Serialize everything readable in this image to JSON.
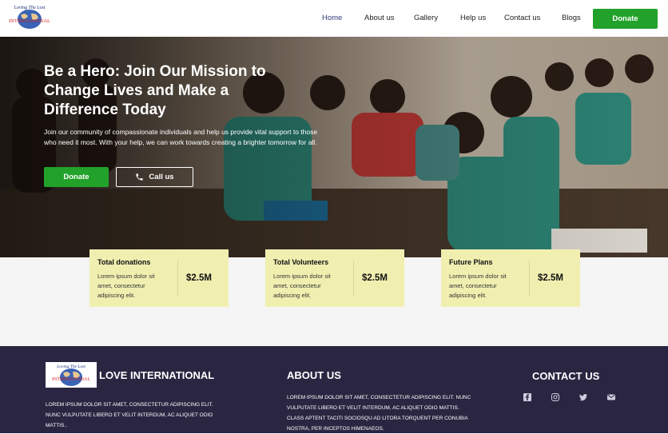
{
  "header": {
    "nav": [
      {
        "label": "Home",
        "active": true
      },
      {
        "label": "About us",
        "active": false
      },
      {
        "label": "Gallery",
        "active": false
      },
      {
        "label": "Help us",
        "active": false
      },
      {
        "label": "Contact us",
        "active": false
      },
      {
        "label": "Blogs",
        "active": false
      }
    ],
    "donate_label": "Donate"
  },
  "hero": {
    "title": "Be a Hero: Join Our Mission to Change Lives and Make a Difference Today",
    "text": "Join our community of compassionate individuals and help us provide vital support to those who need it most. With your help, we can work towards creating a brighter tomorrow for all.",
    "donate_label": "Donate",
    "call_label": "Call us"
  },
  "stats": [
    {
      "title": "Total donations",
      "desc": "Lorem ipsum dolor sit amet, consectetur adipiscing elit.",
      "value": "$2.5M"
    },
    {
      "title": "Total Volunteers",
      "desc": "Lorem ipsum dolor sit amet, consectetur adipiscing elit.",
      "value": "$2.5M"
    },
    {
      "title": "Future Plans",
      "desc": "Lorem ipsum dolor sit amet, consectetur adipiscing elit.",
      "value": "$2.5M"
    }
  ],
  "footer": {
    "brand": "LOVE INTERNATIONAL",
    "brand_text": "LOREM IPSUM DOLOR SIT AMET, CONSECTETUR ADIPISCING ELIT. NUNC VULPUTATE LIBERO ET VELIT INTERDUM, AC ALIQUET ODIO MATTIS..",
    "about_heading": "ABOUT US",
    "about_text": "LOREM IPSUM DOLOR SIT AMET, CONSECTETUR ADIPISCING ELIT. NUNC VULPUTATE LIBERO ET VELIT INTERDUM, AC ALIQUET ODIO MATTIS. CLASS APTENT TACITI SOCIOSQU AD LITORA TORQUENT PER CONUBIA NOSTRA, PER INCEPTOS HIMENAEOS.",
    "contact_heading": "CONTACT US",
    "socials": [
      "facebook-icon",
      "instagram-icon",
      "twitter-icon",
      "mail-icon"
    ]
  },
  "logo": {
    "script_text": "Loving The Lost",
    "wordmark": "INTERNATIONAL"
  },
  "colors": {
    "accent_green": "#22a22a",
    "footer_bg": "#2a2642",
    "card_bg": "#f1efb0",
    "nav_active": "#2f3c7a"
  }
}
